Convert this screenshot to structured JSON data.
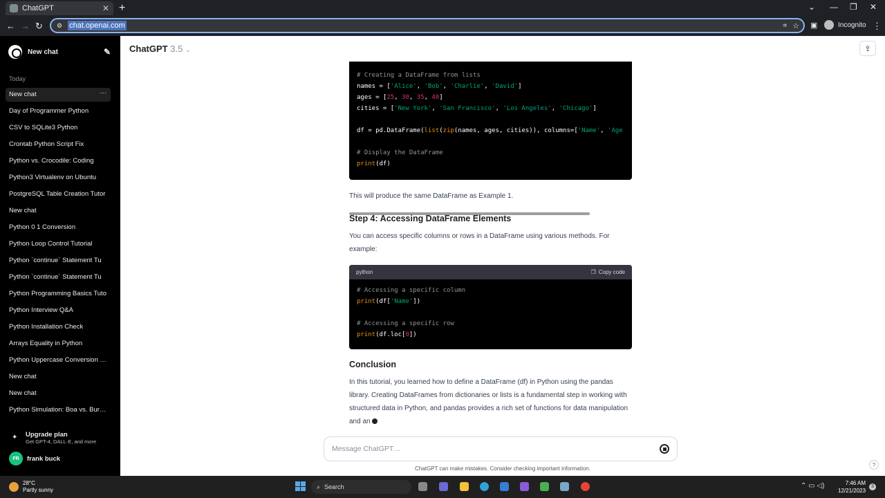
{
  "browser": {
    "tab_title": "ChatGPT",
    "url": "chat.openai.com",
    "incognito_label": "Incognito"
  },
  "sidebar": {
    "new_chat_label": "New chat",
    "section_today": "Today",
    "items": [
      "New chat",
      "Day of Programmer Python",
      "CSV to SQLite3 Python",
      "Crontab Python Script Fix",
      "Python vs. Crocodile: Coding",
      "Python3 Virtualenv on Ubuntu",
      "PostgreSQL Table Creation Tutor",
      "New chat",
      "Python 0 1 Conversion",
      "Python Loop Control Tutorial",
      "Python `continue` Statement Tu",
      "Python `continue` Statement Tu",
      "Python Programming Basics Tuto",
      "Python Interview Q&A",
      "Python Installation Check",
      "Arrays Equality in Python",
      "Python Uppercase Conversion Tu",
      "New chat",
      "New chat",
      "Python Simulation: Boa vs. Burme"
    ],
    "upgrade_title": "Upgrade plan",
    "upgrade_sub": "Get GPT-4, DALL·E, and more",
    "user_initials": "FR",
    "user_name": "frank buck"
  },
  "header": {
    "model_name": "ChatGPT",
    "model_version": "3.5"
  },
  "content": {
    "code1": {
      "line1": "# Creating a DataFrame from lists",
      "names_var": "names = [",
      "names_vals": [
        "'Alice'",
        "'Bob'",
        "'Charlie'",
        "'David'"
      ],
      "ages_var": "ages = [",
      "ages_vals": [
        "25",
        "30",
        "35",
        "40"
      ],
      "cities_var": "cities = [",
      "cities_vals": [
        "'New York'",
        "'San Francisco'",
        "'Los Angeles'",
        "'Chicago'"
      ],
      "df_prefix": "df = pd.DataFrame(",
      "df_fn1": "list",
      "df_fn2": "zip",
      "df_middle": "(names, ages, cities)), columns=[",
      "df_col1": "'Name'",
      "df_col2": "'Age",
      "comment2": "# Display the DataFrame",
      "print_fn": "print",
      "print_arg": "(df)"
    },
    "p1": "This will produce the same DataFrame as Example 1.",
    "h_step4": "Step 4: Accessing DataFrame Elements",
    "p2": "You can access specific columns or rows in a DataFrame using various methods. For example:",
    "code2": {
      "lang": "python",
      "copy_label": "Copy code",
      "c1": "# Accessing a specific column",
      "print_fn": "print",
      "l2_mid": "(df[",
      "l2_str": "'Name'",
      "l2_end": "])",
      "c2": "# Accessing a specific row",
      "l4_mid": "(df.loc[",
      "l4_num": "0",
      "l4_end": "])"
    },
    "h_conclusion": "Conclusion",
    "p3": "In this tutorial, you learned how to define a DataFrame (df) in Python using the pandas library. Creating DataFrames from dictionaries or lists is a fundamental step in working with structured data in Python, and pandas provides a rich set of functions for data manipulation and an"
  },
  "composer": {
    "placeholder": "Message ChatGPT…",
    "disclaimer": "ChatGPT can make mistakes. Consider checking important information."
  },
  "taskbar": {
    "temp": "28°C",
    "weather": "Partly sunny",
    "search": "Search",
    "time": "7:46 AM",
    "date": "12/21/2023",
    "notif_count": "3"
  }
}
